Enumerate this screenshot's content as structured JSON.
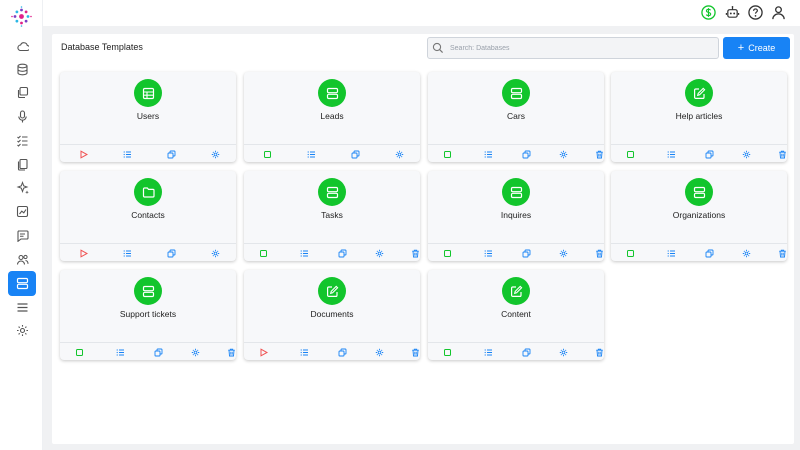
{
  "app": {
    "page_title": "Database Templates"
  },
  "search": {
    "placeholder": "Search: Databases"
  },
  "create_button": {
    "label": "Create",
    "icon": "plus-icon"
  },
  "colors": {
    "accent": "#1883f5",
    "card_icon_bg": "#12c52c",
    "play": "#f05252",
    "stop": "#12c52c",
    "blue": "#1883f5",
    "trash": "#1883f5"
  },
  "sidebar": {
    "items": [
      {
        "name": "cloud-icon"
      },
      {
        "name": "database-icon"
      },
      {
        "name": "copy-icon"
      },
      {
        "name": "microphone-icon"
      },
      {
        "name": "checklist-icon"
      },
      {
        "name": "documents-icon"
      },
      {
        "name": "sparkles-icon"
      },
      {
        "name": "chart-icon"
      },
      {
        "name": "chat-icon"
      },
      {
        "name": "users-icon"
      },
      {
        "name": "server-icon",
        "active": true
      },
      {
        "name": "menu-icon"
      },
      {
        "name": "gear-icon"
      }
    ]
  },
  "topbar": {
    "icons": [
      "dollar-icon",
      "robot-icon",
      "help-icon",
      "user-icon"
    ]
  },
  "cards": [
    {
      "title": "Users",
      "icon": "table-icon",
      "actions": [
        "play",
        "list",
        "copy",
        "settings"
      ]
    },
    {
      "title": "Leads",
      "icon": "server-icon",
      "actions": [
        "stop",
        "list",
        "copy",
        "settings"
      ]
    },
    {
      "title": "Cars",
      "icon": "server-icon",
      "actions": [
        "stop",
        "list",
        "copy",
        "settings",
        "delete"
      ]
    },
    {
      "title": "Help articles",
      "icon": "edit-icon",
      "actions": [
        "stop",
        "list",
        "copy",
        "settings",
        "delete"
      ]
    },
    {
      "title": "Contacts",
      "icon": "folder-icon",
      "actions": [
        "play",
        "list",
        "copy",
        "settings"
      ]
    },
    {
      "title": "Tasks",
      "icon": "server-icon",
      "actions": [
        "stop",
        "list",
        "copy",
        "settings",
        "delete"
      ]
    },
    {
      "title": "Inquires",
      "icon": "server-icon",
      "actions": [
        "stop",
        "list",
        "copy",
        "settings",
        "delete"
      ]
    },
    {
      "title": "Organizations",
      "icon": "server-icon",
      "actions": [
        "stop",
        "list",
        "copy",
        "settings",
        "delete"
      ]
    },
    {
      "title": "Support tickets",
      "icon": "server-icon",
      "actions": [
        "stop",
        "list",
        "copy",
        "settings",
        "delete"
      ]
    },
    {
      "title": "Documents",
      "icon": "edit-icon",
      "actions": [
        "play",
        "list",
        "copy",
        "settings",
        "delete"
      ]
    },
    {
      "title": "Content",
      "icon": "edit-icon",
      "actions": [
        "stop",
        "list",
        "copy",
        "settings",
        "delete"
      ]
    }
  ]
}
